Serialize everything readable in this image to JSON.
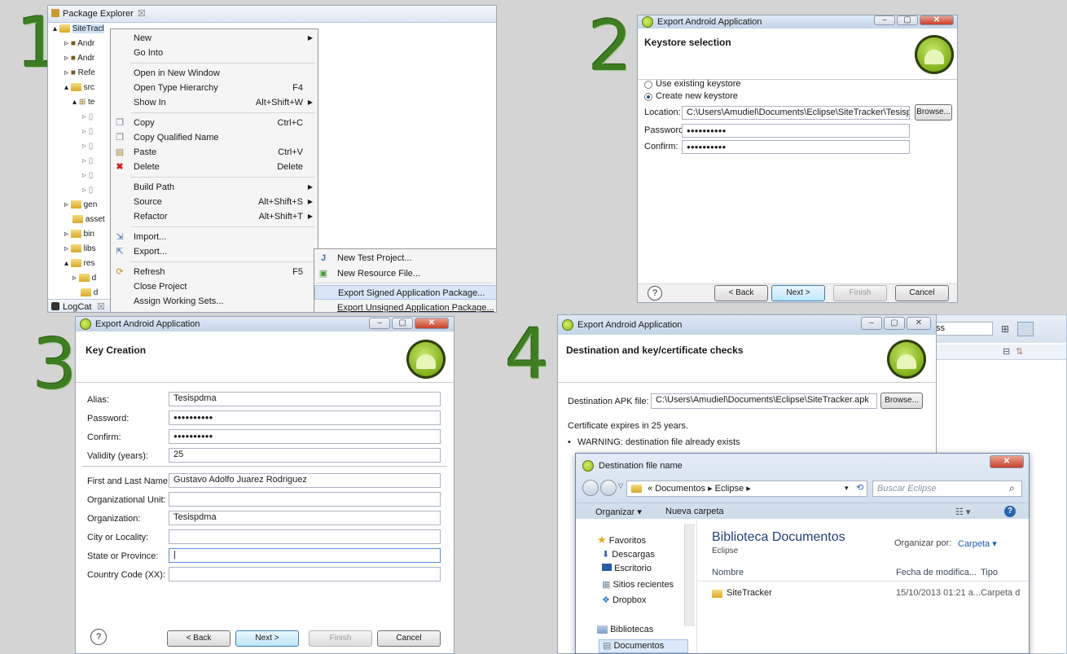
{
  "steps": {
    "s1": "1",
    "s2": "2",
    "s3": "3",
    "s4": "4"
  },
  "p1": {
    "package_explorer_tab": "Package Explorer",
    "logcat_tab": "LogCat",
    "tab_close": "☒",
    "tree": {
      "project": "SiteTracl",
      "lib1": "Andr",
      "lib2": "Andr",
      "refs": "Refe",
      "src": "src",
      "pkg": "te",
      "gen": "gen",
      "assets": "asset",
      "bin": "bin",
      "libs": "libs",
      "res": "res",
      "res_d1": "d",
      "res_d2": "d"
    },
    "menu": {
      "new": "New",
      "go_into": "Go Into",
      "open_new_window": "Open in New Window",
      "open_type_hierarchy": "Open Type Hierarchy",
      "open_type_hierarchy_key": "F4",
      "show_in": "Show In",
      "show_in_key": "Alt+Shift+W",
      "copy": "Copy",
      "copy_key": "Ctrl+C",
      "copy_qualified": "Copy Qualified Name",
      "paste": "Paste",
      "paste_key": "Ctrl+V",
      "delete": "Delete",
      "delete_key": "Delete",
      "build_path": "Build Path",
      "source": "Source",
      "source_key": "Alt+Shift+S",
      "refactor": "Refactor",
      "refactor_key": "Alt+Shift+T",
      "import": "Import...",
      "export": "Export...",
      "refresh": "Refresh",
      "refresh_key": "F5",
      "close_project": "Close Project",
      "assign_working_sets": "Assign Working Sets..."
    },
    "submenu": {
      "new_test_project": "New Test Project...",
      "new_resource_file": "New Resource File...",
      "export_signed": "Export Signed Application Package...",
      "export_unsigned": "Export Unsigned Application Package..."
    }
  },
  "p2": {
    "title": "Export Android Application",
    "header": "Keystore selection",
    "use_existing": "Use existing keystore",
    "create_new": "Create new keystore",
    "location_label": "Location:",
    "location_value": "C:\\Users\\Amudiel\\Documents\\Eclipse\\SiteTracker\\Tesispdma.key",
    "browse": "Browse...",
    "password_label": "Password:",
    "password_value": "●●●●●●●●●●",
    "confirm_label": "Confirm:",
    "confirm_value": "●●●●●●●●●●",
    "back": "< Back",
    "next": "Next >",
    "finish": "Finish",
    "cancel": "Cancel",
    "help": "?"
  },
  "p3": {
    "title": "Export Android Application",
    "header": "Key Creation",
    "alias_label": "Alias:",
    "alias_value": "Tesispdma",
    "password_label": "Password:",
    "password_value": "●●●●●●●●●●",
    "confirm_label": "Confirm:",
    "confirm_value": "●●●●●●●●●●",
    "validity_label": "Validity (years):",
    "validity_value": "25",
    "name_label": "First and Last Name:",
    "name_value": "Gustavo Adolfo Juarez Rodriguez",
    "org_unit_label": "Organizational Unit:",
    "org_unit_value": "",
    "org_label": "Organization:",
    "org_value": "Tesispdma",
    "city_label": "City or Locality:",
    "city_value": "",
    "state_label": "State or Province:",
    "state_value": "|",
    "country_label": "Country Code (XX):",
    "country_value": "",
    "back": "< Back",
    "next": "Next >",
    "finish": "Finish",
    "cancel": "Cancel",
    "help": "?"
  },
  "p4": {
    "title": "Export Android Application",
    "header": "Destination and key/certificate checks",
    "dest_label": "Destination APK file:",
    "dest_value": "C:\\Users\\Amudiel\\Documents\\Eclipse\\SiteTracker.apk",
    "browse": "Browse...",
    "expires": "Certificate expires in 25 years.",
    "warning": "WARNING: destination file already exists",
    "bg_ss": "ss",
    "file_dialog": {
      "title": "Destination file name",
      "breadcrumb_prefix": "«",
      "crumb1": "Documentos",
      "crumb2": "Eclipse",
      "search_placeholder": "Buscar Eclipse",
      "organize": "Organizar",
      "new_folder": "Nueva carpeta",
      "nav": {
        "favorites": "Favoritos",
        "downloads": "Descargas",
        "desktop": "Escritorio",
        "recent": "Sitios recientes",
        "dropbox": "Dropbox",
        "libraries": "Bibliotecas",
        "documents": "Documentos"
      },
      "library_title": "Biblioteca Documentos",
      "library_sub": "Eclipse",
      "organize_by_label": "Organizar por:",
      "organize_by_value": "Carpeta",
      "col_name": "Nombre",
      "col_date": "Fecha de modifica...",
      "col_type": "Tipo",
      "row_name": "SiteTracker",
      "row_date": "15/10/2013 01:21 a...",
      "row_type": "Carpeta d"
    }
  }
}
